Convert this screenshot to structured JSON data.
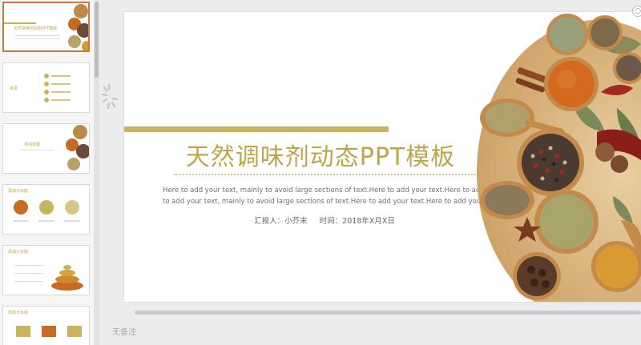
{
  "slide": {
    "title": "天然调味剂动态PPT模板",
    "body_line1": "Here to add your text, mainly to avoid large sections of text.Here to add your text.Here to add your textHere",
    "body_line2": "to add your text, mainly to avoid large sections of text.Here to add your text.Here to add your text",
    "reporter": "汇报人：小芥末",
    "time": "时间：2018年X月X日"
  },
  "thumbnails": [
    {
      "title": "天然调味剂动态PPT模板"
    },
    {
      "title": "目录"
    },
    {
      "title": "添加标题"
    },
    {
      "title": "添加大标题"
    },
    {
      "title": "添加大标题"
    },
    {
      "title": "添加大标题"
    }
  ],
  "notes": {
    "placeholder": "无备注"
  },
  "colors": {
    "accent": "#c8b45a",
    "title": "#c2a448",
    "active_border": "#c97a3a"
  }
}
